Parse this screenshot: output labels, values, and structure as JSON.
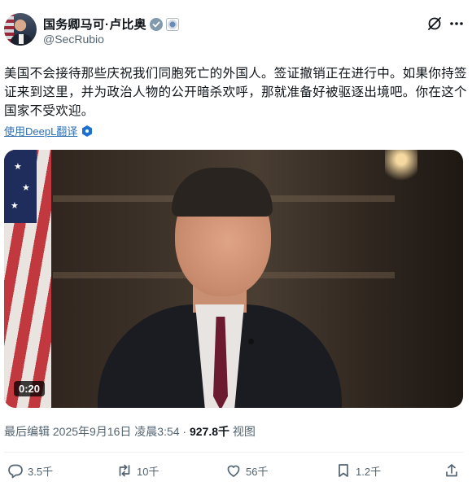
{
  "author": {
    "display_name": "国务卿马可·卢比奥",
    "handle": "@SecRubio"
  },
  "tweet": {
    "text": "美国不会接待那些庆祝我们同胞死亡的外国人。签证撤销正在进行中。如果你持签证来到这里，并为政治人物的公开暗杀欢呼，那就准备好被驱逐出境吧。你在这个国家不受欢迎。",
    "translate_label": "使用DeepL翻译"
  },
  "video": {
    "duration": "0:20"
  },
  "meta": {
    "edited_prefix": "最后编辑",
    "timestamp": "2025年9月16日 凌晨3:54",
    "separator": "·",
    "views_count": "927.8千",
    "views_label": "视图"
  },
  "actions": {
    "replies": "3.5千",
    "retweets": "10千",
    "likes": "56千",
    "bookmarks": "1.2千"
  },
  "icons": {
    "verified": "verified-badge-icon",
    "seal": "government-seal-icon",
    "grok": "grok-icon",
    "more": "more-icon",
    "reply": "reply-icon",
    "retweet": "retweet-icon",
    "like": "heart-icon",
    "bookmark": "bookmark-icon",
    "share": "share-icon"
  },
  "colors": {
    "text": "#0f1419",
    "secondary": "#536471",
    "link": "#1d9bf0",
    "verified_gray": "#829aab"
  }
}
